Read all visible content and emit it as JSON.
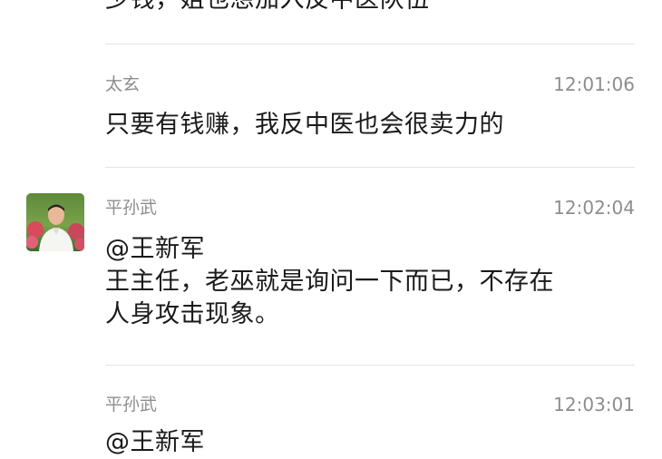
{
  "messages": [
    {
      "lines": [
        "少钱，姐也想加入反中医队伍"
      ]
    },
    {
      "sender": "太玄",
      "time": "12:01:06",
      "lines": [
        "只要有钱赚，我反中医也会很卖力的"
      ]
    },
    {
      "sender": "平孙武",
      "time": "12:02:04",
      "avatar": "user-photo-avatar",
      "lines": [
        "@王新军",
        "王主任，老巫就是询问一下而已，不存在",
        "人身攻击现象。"
      ]
    },
    {
      "sender": "平孙武",
      "time": "12:03:01",
      "lines": [
        "@王新军"
      ]
    }
  ],
  "colors": {
    "meta": "#8d8d8d",
    "text": "#1a1a1a",
    "divider": "#e3e3e3"
  }
}
